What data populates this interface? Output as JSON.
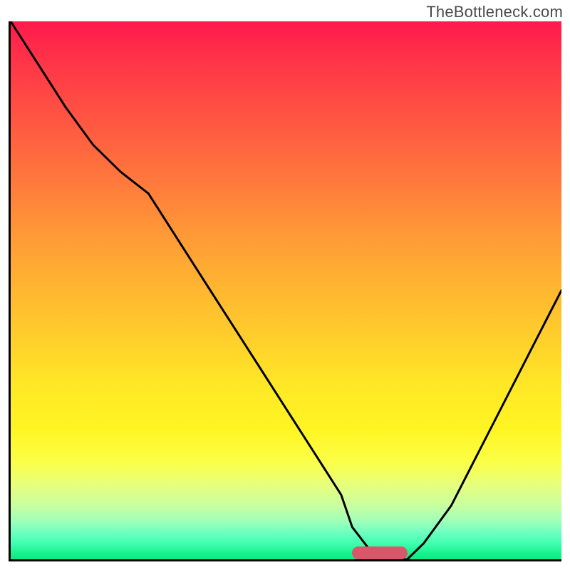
{
  "watermark": "TheBottleneck.com",
  "chart_data": {
    "type": "line",
    "title": "",
    "xlabel": "",
    "ylabel": "",
    "xlim": [
      0,
      100
    ],
    "ylim": [
      0,
      100
    ],
    "x": [
      0,
      5,
      10,
      15,
      20,
      25,
      30,
      35,
      40,
      45,
      50,
      55,
      60,
      62,
      65,
      68,
      70,
      72,
      75,
      80,
      85,
      90,
      95,
      100
    ],
    "values": [
      100,
      92,
      84,
      77,
      72,
      68,
      60,
      52,
      44,
      36,
      28,
      20,
      12,
      6,
      2,
      0,
      0,
      0,
      3,
      10,
      20,
      30,
      40,
      50
    ],
    "marker": {
      "x_start": 62,
      "x_end": 72,
      "y": 1.2
    },
    "background_gradient": {
      "top": "#ff1a4d",
      "mid": "#ffd22a",
      "bottom": "#10e880"
    },
    "curve_color": "#000000"
  }
}
